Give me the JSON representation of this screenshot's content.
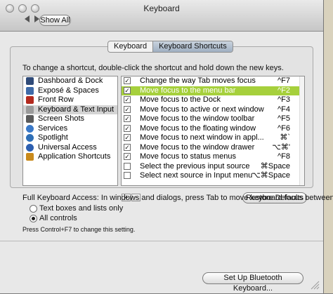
{
  "window": {
    "title": "Keyboard",
    "show_all_label": "Show All"
  },
  "tabs": [
    {
      "label": "Keyboard",
      "selected": false
    },
    {
      "label": "Keyboard Shortcuts",
      "selected": true
    }
  ],
  "instructions": "To change a shortcut, double-click the shortcut and hold down the new keys.",
  "categories": [
    {
      "label": "Dashboard & Dock",
      "icon": "dashboard-dock-icon",
      "color": "#2f4a78"
    },
    {
      "label": "Exposé & Spaces",
      "icon": "expose-spaces-icon",
      "color": "#3e6aa8"
    },
    {
      "label": "Front Row",
      "icon": "front-row-icon",
      "color": "#b32a1e"
    },
    {
      "label": "Keyboard & Text Input",
      "icon": "keyboard-text-input-icon",
      "color": "#9a9a9a",
      "selected": true
    },
    {
      "label": "Screen Shots",
      "icon": "screen-shots-icon",
      "color": "#5b5b5b"
    },
    {
      "label": "Services",
      "icon": "services-gear-icon",
      "color": "#3a79c8"
    },
    {
      "label": "Spotlight",
      "icon": "spotlight-icon",
      "color": "#2f6fb6"
    },
    {
      "label": "Universal Access",
      "icon": "universal-access-icon",
      "color": "#2d5fb0"
    },
    {
      "label": "Application Shortcuts",
      "icon": "application-shortcuts-icon",
      "color": "#c98a1c"
    }
  ],
  "shortcuts": [
    {
      "checked": true,
      "label": "Change the way Tab moves focus",
      "key": "^F7"
    },
    {
      "checked": true,
      "label": "Move focus to the menu bar",
      "key": "^F2",
      "selected": true
    },
    {
      "checked": true,
      "label": "Move focus to the Dock",
      "key": "^F3"
    },
    {
      "checked": true,
      "label": "Move focus to active or next window",
      "key": "^F4"
    },
    {
      "checked": true,
      "label": "Move focus to the window toolbar",
      "key": "^F5"
    },
    {
      "checked": true,
      "label": "Move focus to the floating window",
      "key": "^F6"
    },
    {
      "checked": true,
      "label": "Move focus to next window in appl...",
      "key": "⌘`"
    },
    {
      "checked": true,
      "label": "Move focus to the window drawer",
      "key": "⌥⌘'"
    },
    {
      "checked": true,
      "label": "Move focus to status menus",
      "key": "^F8"
    },
    {
      "checked": false,
      "label": "Select the previous input source",
      "key": "⌘Space"
    },
    {
      "checked": false,
      "label": "Select next source in Input menu",
      "key": "⌥⌘Space"
    }
  ],
  "list_buttons": {
    "add": "+",
    "remove": "−"
  },
  "restore_defaults_label": "Restore Defaults",
  "full_access": {
    "text": "Full Keyboard Access: In windows and dialogs, press Tab to move keyboard focus between:",
    "options": [
      {
        "label": "Text boxes and lists only",
        "selected": false
      },
      {
        "label": "All controls",
        "selected": true
      }
    ],
    "hint": "Press Control+F7 to change this setting."
  },
  "bluetooth_button_label": "Set Up Bluetooth Keyboard..."
}
